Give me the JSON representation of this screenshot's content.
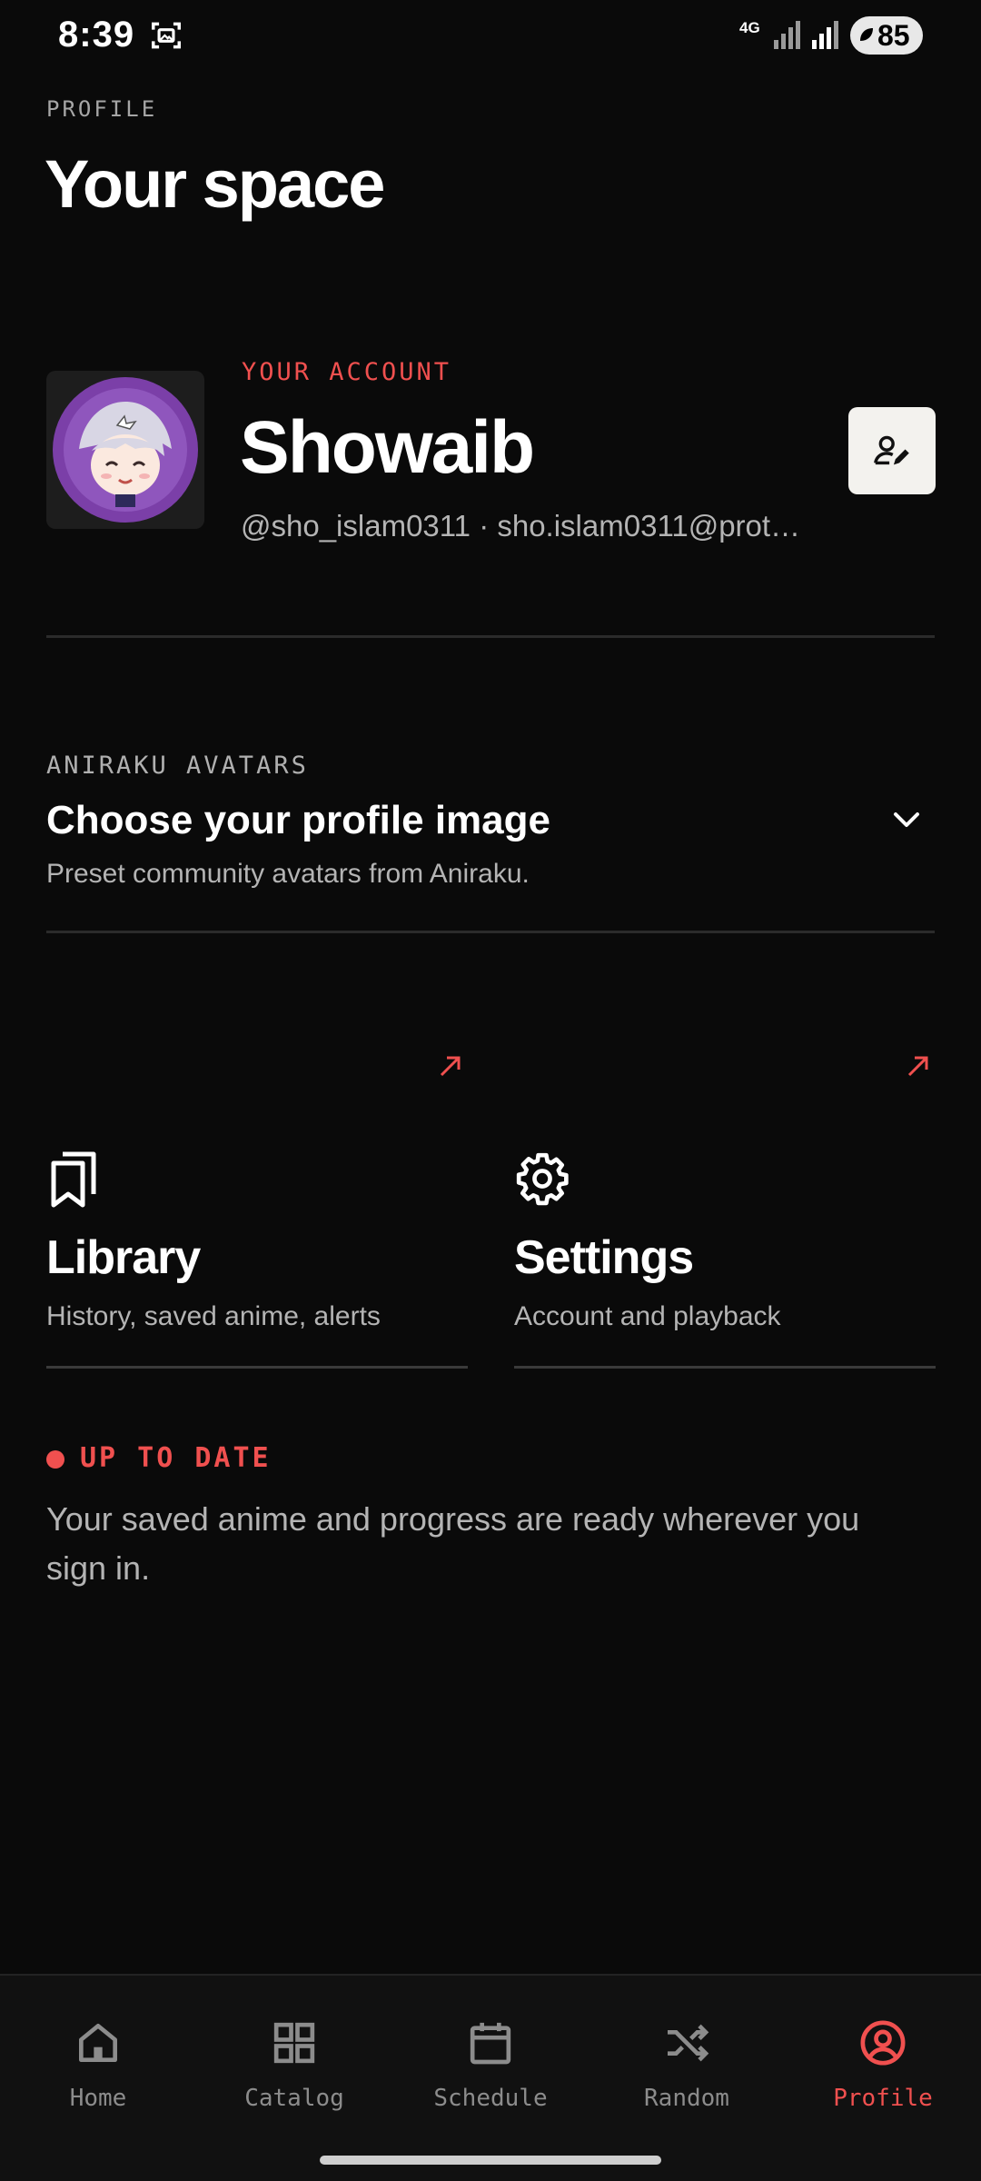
{
  "status_bar": {
    "time": "8:39",
    "network": "4G",
    "battery": "85",
    "icons": [
      "screenshot-icon",
      "signal-icon",
      "signal-icon",
      "battery-icon"
    ]
  },
  "header": {
    "eyebrow": "PROFILE",
    "title": "Your space"
  },
  "account": {
    "eyebrow": "YOUR ACCOUNT",
    "name": "Showaib",
    "subtitle": "@sho_islam0311 · sho.islam0311@prot…",
    "edit_icon": "edit-profile-icon"
  },
  "avatars": {
    "eyebrow": "ANIRAKU AVATARS",
    "title": "Choose your profile image",
    "description": "Preset community avatars from Aniraku.",
    "toggle_icon": "chevron-down-icon"
  },
  "cards": [
    {
      "title": "Library",
      "description": "History, saved anime, alerts",
      "icon": "bookmarks-icon"
    },
    {
      "title": "Settings",
      "description": "Account and playback",
      "icon": "gear-icon"
    }
  ],
  "sync_status": {
    "eyebrow": "UP TO DATE",
    "text": "Your saved anime and progress are ready wherever you sign in."
  },
  "nav": {
    "items": [
      {
        "label": "Home",
        "icon": "home-icon"
      },
      {
        "label": "Catalog",
        "icon": "grid-icon"
      },
      {
        "label": "Schedule",
        "icon": "calendar-icon"
      },
      {
        "label": "Random",
        "icon": "shuffle-icon"
      },
      {
        "label": "Profile",
        "icon": "profile-icon",
        "active": true
      }
    ]
  },
  "colors": {
    "background": "#0a0a0a",
    "accent": "#f0504f",
    "muted_text": "#b4b4b4",
    "nav_inactive": "#8c8c8c"
  }
}
